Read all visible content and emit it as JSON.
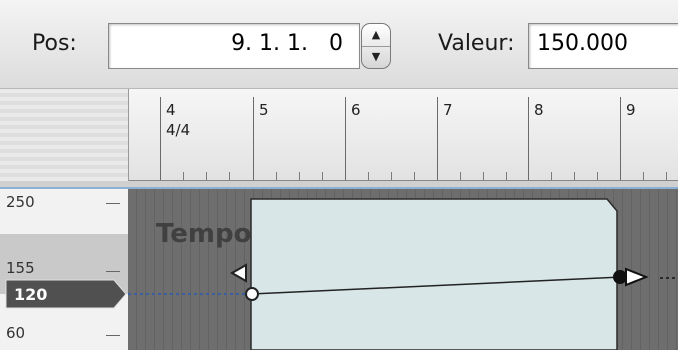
{
  "toolbar": {
    "pos_label": "Pos:",
    "pos_value": "9. 1. 1.   0",
    "valeur_label": "Valeur:",
    "valeur_value": "150.000"
  },
  "ruler": {
    "bars": [
      "4",
      "5",
      "6",
      "7",
      "8",
      "9"
    ],
    "time_signature": "4/4"
  },
  "track": {
    "title": "Tempo",
    "scale_labels": [
      "250",
      "155",
      "60"
    ],
    "current_value": "120"
  },
  "colors": {
    "region_fill": "#d8e6e8",
    "track_bg": "#6a6a6a",
    "selection_border": "#8ab0d8"
  },
  "icons": {
    "stepper_up": "triangle-up-icon",
    "stepper_down": "triangle-down-icon",
    "left_node": "triangle-left-icon",
    "right_node": "triangle-right-icon"
  }
}
